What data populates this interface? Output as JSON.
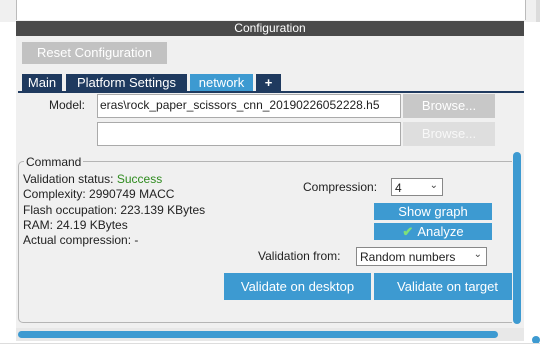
{
  "header": {
    "title": "Configuration"
  },
  "toolbar": {
    "reset_label": "Reset Configuration"
  },
  "tabs": [
    {
      "label": "Main",
      "active": false
    },
    {
      "label": "Platform Settings",
      "active": false
    },
    {
      "label": "network",
      "active": true
    },
    {
      "label": "+",
      "active": false
    }
  ],
  "model": {
    "label": "Model:",
    "path_value": "eras\\rock_paper_scissors_cnn_20190226052228.h5",
    "second_value": "",
    "browse_label": "Browse...",
    "browse2_label": "Browse..."
  },
  "command": {
    "title": "Command",
    "validation_status_label": "Validation status:",
    "validation_status_value": "Success",
    "complexity": "Complexity: 2990749 MACC",
    "flash": "Flash occupation: 223.139 KBytes",
    "ram": "RAM: 24.19 KBytes",
    "actual_compression": "Actual compression: -",
    "compression_label": "Compression:",
    "compression_value": "4",
    "show_graph_label": "Show graph",
    "analyze_label": "Analyze",
    "validation_from_label": "Validation from:",
    "validation_from_value": "Random numbers",
    "validate_desktop_label": "Validate on desktop",
    "validate_target_label": "Validate on target"
  },
  "colors": {
    "accent": "#3d9ad1",
    "tab_dark": "#1f3a5f",
    "header_bg": "#4a4a4a",
    "success": "#2e8b1e"
  },
  "icons": {
    "analyze": "checkmark-icon",
    "dropdown": "chevron-down-icon"
  }
}
